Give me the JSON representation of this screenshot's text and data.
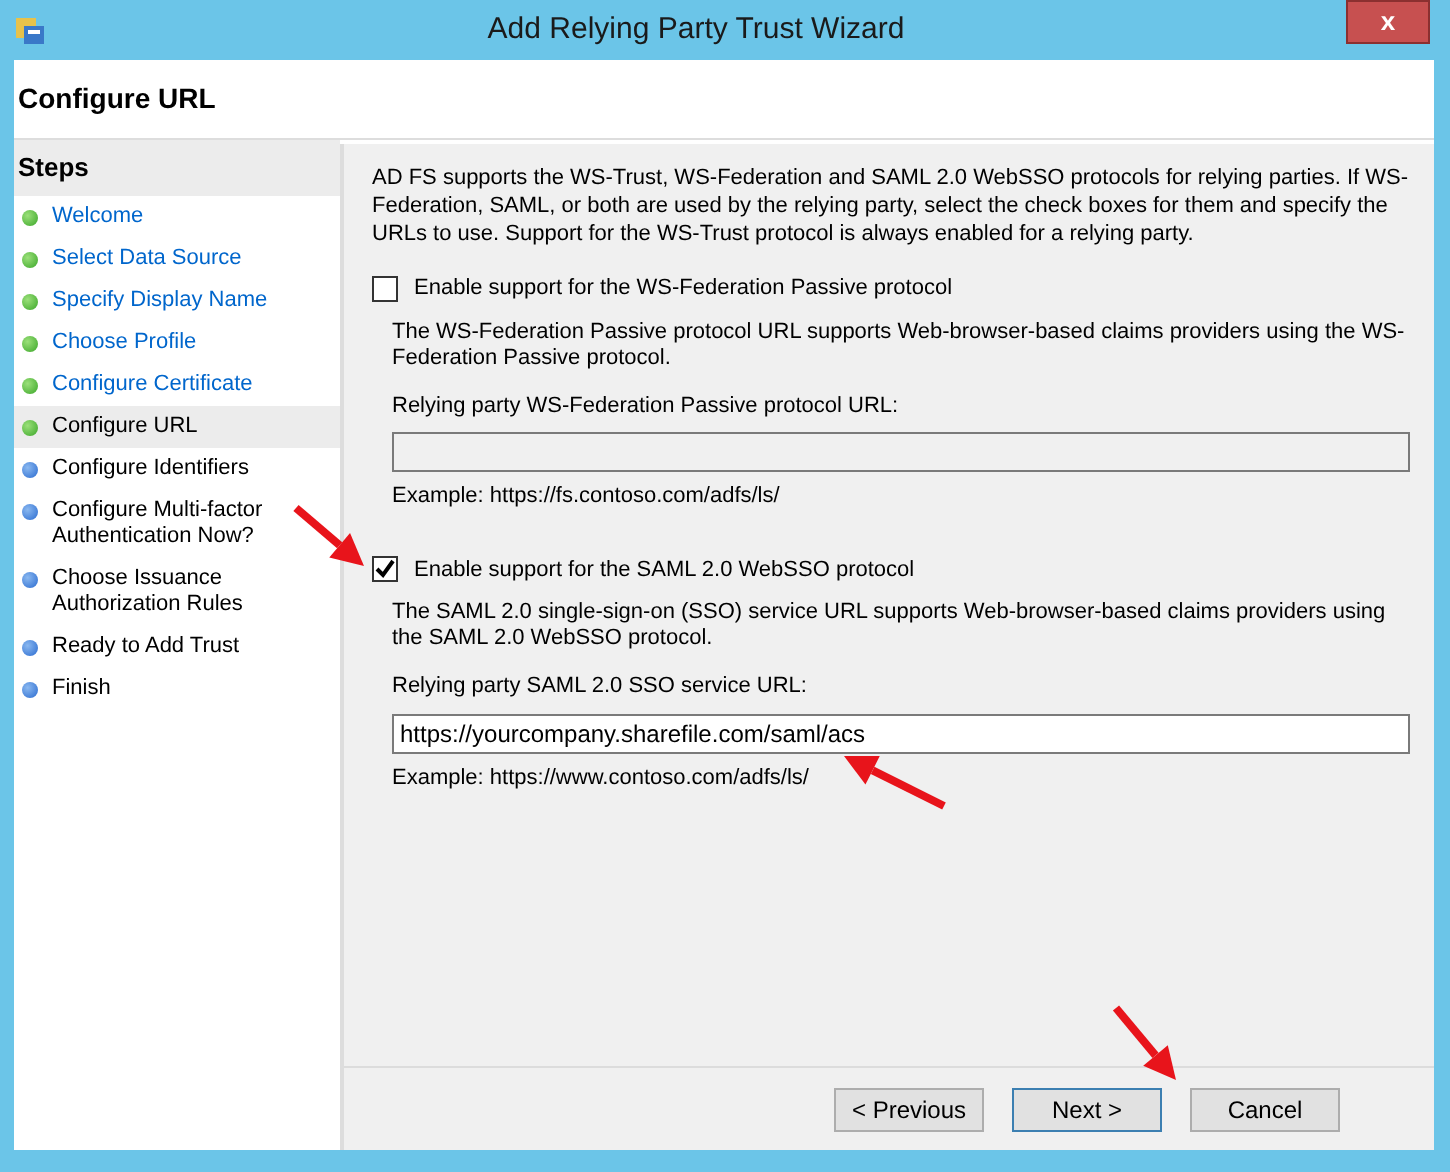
{
  "window": {
    "title": "Add Relying Party Trust Wizard",
    "close": "x"
  },
  "page_title": "Configure URL",
  "steps": {
    "heading": "Steps",
    "items": [
      {
        "label": "Welcome",
        "completed": true,
        "selected": false
      },
      {
        "label": "Select Data Source",
        "completed": true,
        "selected": false
      },
      {
        "label": "Specify Display Name",
        "completed": true,
        "selected": false
      },
      {
        "label": "Choose Profile",
        "completed": true,
        "selected": false
      },
      {
        "label": "Configure Certificate",
        "completed": true,
        "selected": false
      },
      {
        "label": "Configure URL",
        "completed": true,
        "selected": true
      },
      {
        "label": "Configure Identifiers",
        "completed": false,
        "selected": false
      },
      {
        "label": "Configure Multi-factor Authentication Now?",
        "completed": false,
        "selected": false
      },
      {
        "label": "Choose Issuance Authorization Rules",
        "completed": false,
        "selected": false
      },
      {
        "label": "Ready to Add Trust",
        "completed": false,
        "selected": false
      },
      {
        "label": "Finish",
        "completed": false,
        "selected": false
      }
    ]
  },
  "intro": "AD FS supports the WS-Trust, WS-Federation and SAML 2.0 WebSSO protocols for relying parties.  If WS-Federation, SAML, or both are used by the relying party, select the check boxes for them and specify the URLs to use.  Support for the WS-Trust protocol is always enabled for a relying party.",
  "protocols": [
    {
      "label": "Enable support for the WS-Federation Passive protocol",
      "checked": false,
      "description": "The WS-Federation Passive protocol URL supports Web-browser-based claims providers using the WS-Federation Passive protocol.",
      "field_label": "Relying party WS-Federation Passive protocol URL:",
      "disabled": true,
      "example": "Example: https://fs.contoso.com/adfs/ls/"
    },
    {
      "label": "Enable support for the SAML 2.0 WebSSO protocol",
      "checked": true,
      "description": "The SAML 2.0 single-sign-on (SSO) service URL supports Web-browser-based claims providers using the SAML 2.0 WebSSO protocol.",
      "field_label": "Relying party SAML 2.0 SSO service URL:",
      "value": "https://yourcompany.sharefile.com/saml/acs",
      "disabled": false,
      "example": "Example: https://www.contoso.com/adfs/ls/"
    }
  ],
  "buttons": [
    {
      "label": "< Previous",
      "default": false
    },
    {
      "label": "Next >",
      "default": true
    },
    {
      "label": "Cancel",
      "default": false
    }
  ]
}
